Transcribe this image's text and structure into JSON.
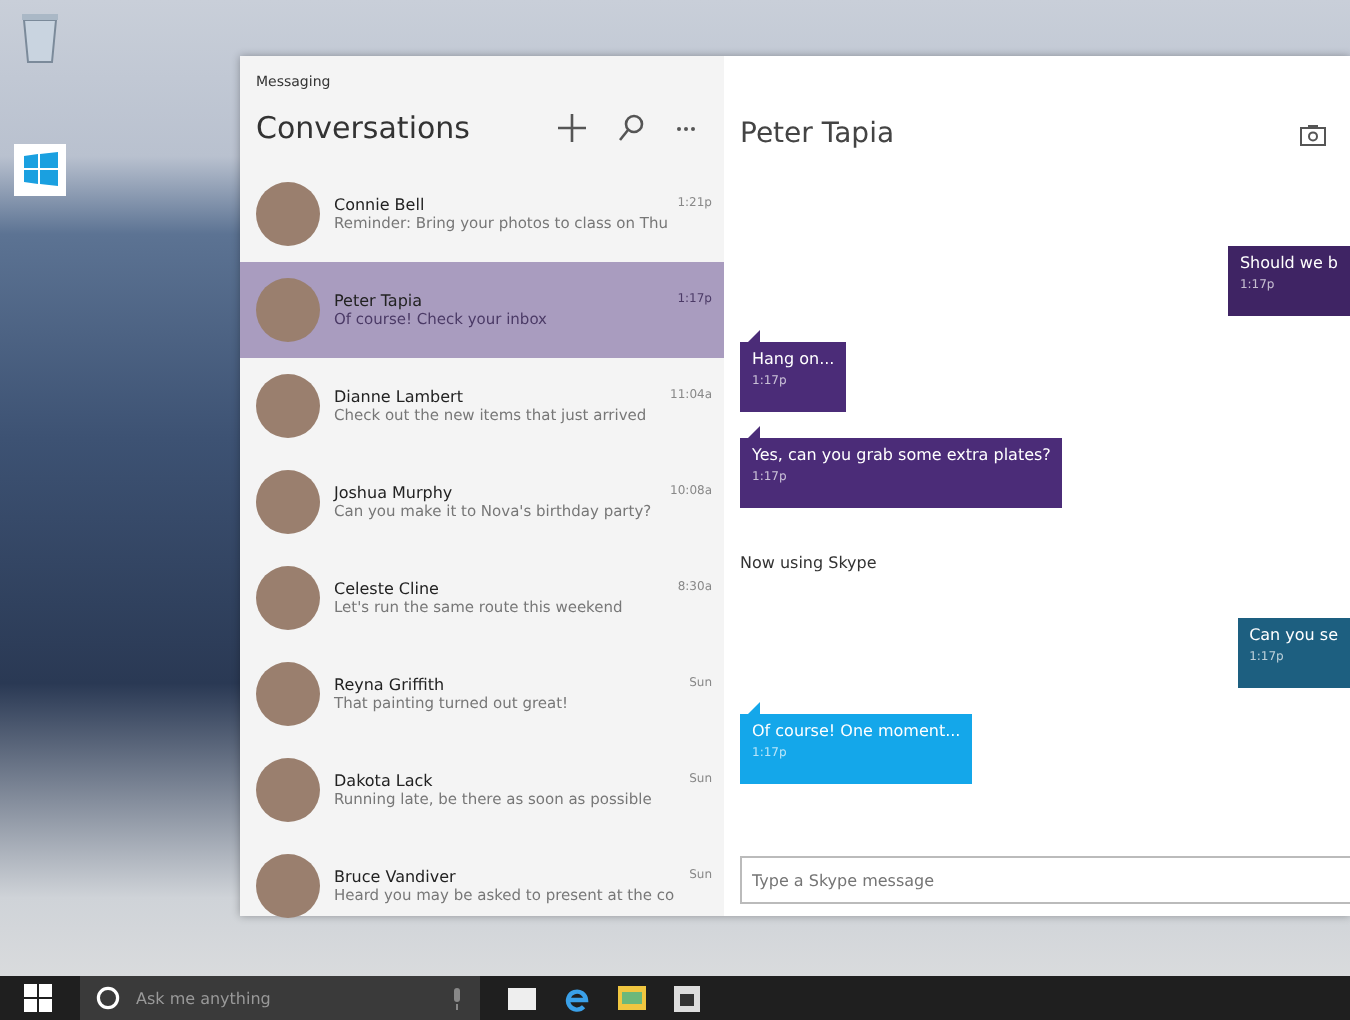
{
  "app": {
    "title": "Messaging",
    "heading": "Conversations"
  },
  "conversations": [
    {
      "name": "Connie Bell",
      "time": "1:21p",
      "preview": "Reminder: Bring your photos to class on Thu",
      "selected": false
    },
    {
      "name": "Peter Tapia",
      "time": "1:17p",
      "preview": "Of course! Check your inbox",
      "selected": true
    },
    {
      "name": "Dianne Lambert",
      "time": "11:04a",
      "preview": "Check out the new items that just arrived",
      "selected": false
    },
    {
      "name": "Joshua Murphy",
      "time": "10:08a",
      "preview": "Can you make it to Nova's birthday party?",
      "selected": false
    },
    {
      "name": "Celeste Cline",
      "time": "8:30a",
      "preview": "Let's run the same route this weekend",
      "selected": false
    },
    {
      "name": "Reyna Griffith",
      "time": "Sun",
      "preview": "That painting turned out great!",
      "selected": false
    },
    {
      "name": "Dakota Lack",
      "time": "Sun",
      "preview": "Running late, be there as soon as possible",
      "selected": false
    },
    {
      "name": "Bruce Vandiver",
      "time": "Sun",
      "preview": "Heard you may be asked to present at the co",
      "selected": false
    }
  ],
  "chat": {
    "contact": "Peter Tapia",
    "messages": [
      {
        "kind": "outgoing",
        "text": "Should we b",
        "time": "1:17p",
        "color": "#3f2464"
      },
      {
        "kind": "incoming",
        "text": "Hang on...",
        "time": "1:17p",
        "color": "#4b2c78"
      },
      {
        "kind": "incoming",
        "text": "Yes, can you grab some extra plates?",
        "time": "1:17p",
        "color": "#4b2c78"
      },
      {
        "kind": "status",
        "text": "Now using Skype"
      },
      {
        "kind": "outgoing",
        "text": "Can you se",
        "time": "1:17p",
        "color": "#1d5f80"
      },
      {
        "kind": "incoming",
        "text": "Of course!  One moment...",
        "time": "1:17p",
        "color": "#14a7ea"
      }
    ],
    "input": {
      "placeholder": "Type a Skype message"
    }
  },
  "taskbar": {
    "search": {
      "placeholder": "Ask me anything"
    }
  }
}
